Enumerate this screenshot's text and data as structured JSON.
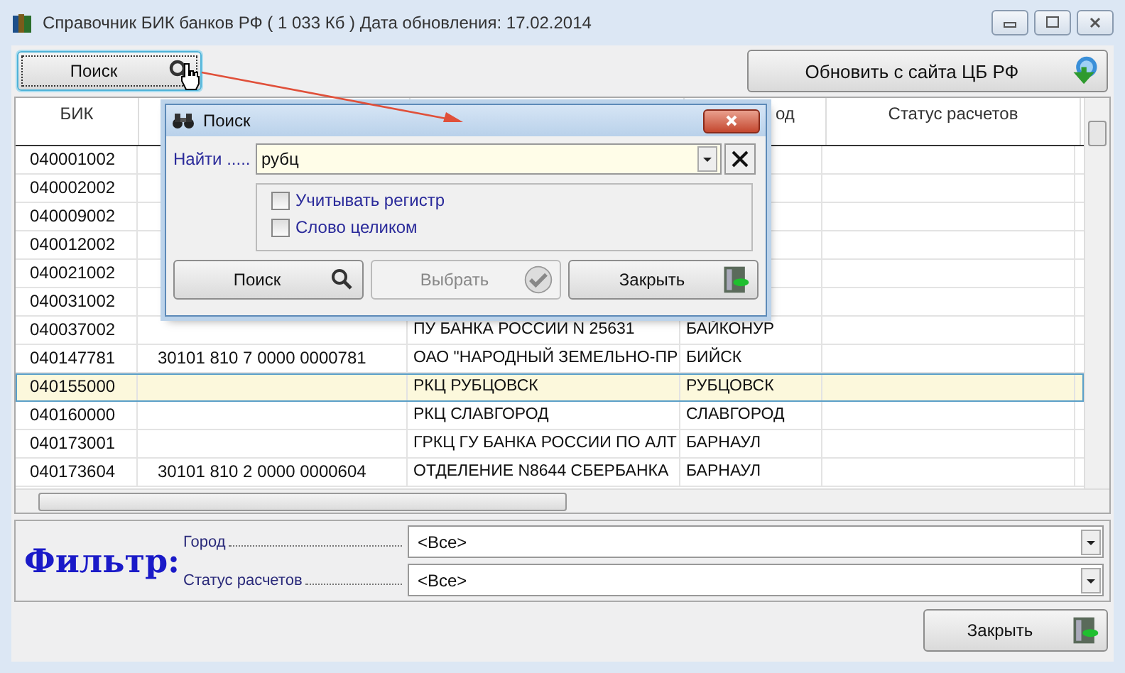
{
  "window": {
    "title": "Справочник БИК банков РФ ( 1 033 Кб ) Дата обновления: 17.02.2014"
  },
  "toolbar": {
    "search_button": "Поиск",
    "update_button": "Обновить с сайта ЦБ РФ"
  },
  "table": {
    "columns": {
      "column_1": "БИК",
      "column_4": "од",
      "column_5": "Статус расчетов"
    },
    "rows": [
      {
        "bik": "040001002",
        "selected": false
      },
      {
        "bik": "040002002",
        "selected": false
      },
      {
        "bik": "040009002",
        "selected": false
      },
      {
        "bik": "040012002",
        "selected": false
      },
      {
        "bik": "040021002",
        "selected": false
      },
      {
        "bik": "040031002",
        "selected": false
      },
      {
        "bik": "040037002",
        "name": "ПУ БАНКА РОССИИ N 25631",
        "city": "БАЙКОНУР",
        "selected": false
      },
      {
        "bik": "040147781",
        "account": "30101 810 7 0000 0000781",
        "name": "ОАО \"НАРОДНЫЙ ЗЕМЕЛЬНО-ПР",
        "city": "БИЙСК",
        "selected": false
      },
      {
        "bik": "040155000",
        "name": "РКЦ РУБЦОВСК",
        "city": "РУБЦОВСК",
        "selected": true
      },
      {
        "bik": "040160000",
        "name": "РКЦ СЛАВГОРОД",
        "city": "СЛАВГОРОД",
        "selected": false
      },
      {
        "bik": "040173001",
        "name": "ГРКЦ ГУ БАНКА РОССИИ ПО АЛТ",
        "city": "БАРНАУЛ",
        "selected": false
      },
      {
        "bik": "040173604",
        "account": "30101 810 2 0000 0000604",
        "name": "ОТДЕЛЕНИЕ N8644 СБЕРБАНКА",
        "city": "БАРНАУЛ",
        "selected": false
      }
    ]
  },
  "dialog": {
    "title": "Поиск",
    "find_label": "Найти .....",
    "find_value": "рубц",
    "options": [
      {
        "label": "Учитывать регистр",
        "checked": false
      },
      {
        "label": "Слово целиком",
        "checked": false
      }
    ],
    "buttons": [
      {
        "label": "Поиск",
        "kind": "search",
        "disabled": false
      },
      {
        "label": "Выбрать",
        "kind": "select",
        "disabled": true
      },
      {
        "label": "Закрыть",
        "kind": "close",
        "disabled": false
      }
    ]
  },
  "filter": {
    "title": "Фильтр:",
    "fields": [
      {
        "label": "Город",
        "value": "<Все>"
      },
      {
        "label": "Статус расчетов",
        "value": "<Все>"
      }
    ]
  },
  "footer": {
    "close_button": "Закрыть"
  }
}
